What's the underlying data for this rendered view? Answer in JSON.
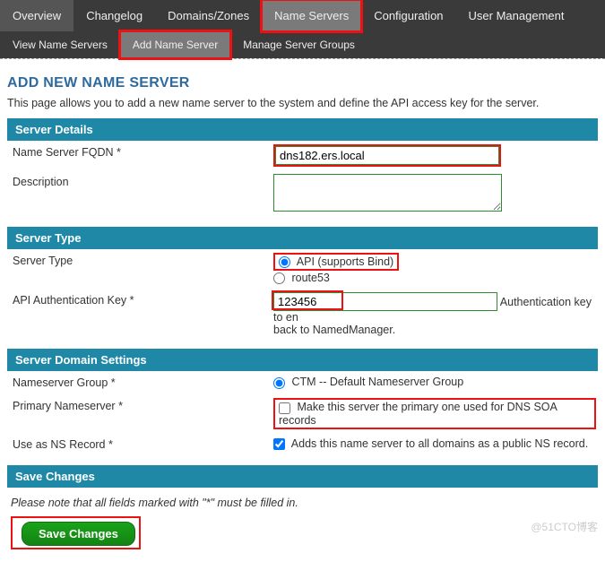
{
  "nav": {
    "primary": [
      "Overview",
      "Changelog",
      "Domains/Zones",
      "Name Servers",
      "Configuration",
      "User Management"
    ],
    "secondary": [
      "View Name Servers",
      "Add Name Server",
      "Manage Server Groups"
    ]
  },
  "page": {
    "title": "ADD NEW NAME SERVER",
    "intro": "This page allows you to add a new name server to the system and define the API access key for the server."
  },
  "server_details": {
    "heading": "Server Details",
    "fqdn_label": "Name Server FQDN *",
    "fqdn_value": "dns182.ers.local",
    "desc_label": "Description",
    "desc_value": ""
  },
  "server_type": {
    "heading": "Server Type",
    "type_label": "Server Type",
    "opt_api": "API (supports Bind)",
    "opt_route53": "route53",
    "selected": "api",
    "api_key_label": "API Authentication Key *",
    "api_key_value": "123456",
    "api_key_hint_right": "Authentication key to en",
    "api_key_hint_below": "back to NamedManager."
  },
  "domain_settings": {
    "heading": "Server Domain Settings",
    "nsgroup_label": "Nameserver Group *",
    "nsgroup_opt": "CTM -- Default Nameserver Group",
    "primary_label": "Primary Nameserver *",
    "primary_check_label": "Make this server the primary one used for DNS SOA records",
    "primary_checked": false,
    "nsrec_label": "Use as NS Record *",
    "nsrec_check_label": "Adds this name server to all domains as a public NS record.",
    "nsrec_checked": true
  },
  "save": {
    "heading": "Save Changes",
    "note": "Please note that all fields marked with \"*\" must be filled in.",
    "button": "Save Changes"
  },
  "watermark": "@51CTO博客"
}
